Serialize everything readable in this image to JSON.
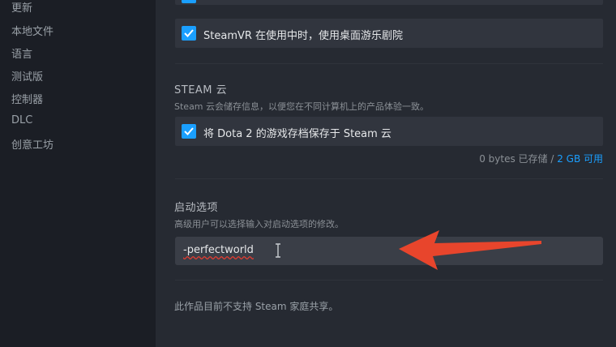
{
  "sidebar": {
    "items": [
      {
        "label": "更新"
      },
      {
        "label": "本地文件"
      },
      {
        "label": "语言"
      },
      {
        "label": "测试版"
      },
      {
        "label": "控制器"
      },
      {
        "label": "DLC"
      },
      {
        "label": "创意工坊"
      }
    ]
  },
  "general": {
    "steamvr_option": "SteamVR 在使用中时，使用桌面游乐剧院"
  },
  "cloud": {
    "title": "STEAM 云",
    "description": "Steam 云会储存信息，以便您在不同计算机上的产品体验一致。",
    "checkbox_label": "将 Dota 2 的游戏存档保存于 Steam 云",
    "storage_used": "0 bytes 已存储",
    "storage_separator": " / ",
    "storage_available": "2 GB 可用"
  },
  "launch": {
    "title": "启动选项",
    "description": "高级用户可以选择输入对启动选项的修改。",
    "value": "-perfectworld"
  },
  "family": {
    "note": "此作品目前不支持 Steam 家庭共享。"
  },
  "colors": {
    "accent": "#1a9fff",
    "arrow": "#e8452c"
  }
}
